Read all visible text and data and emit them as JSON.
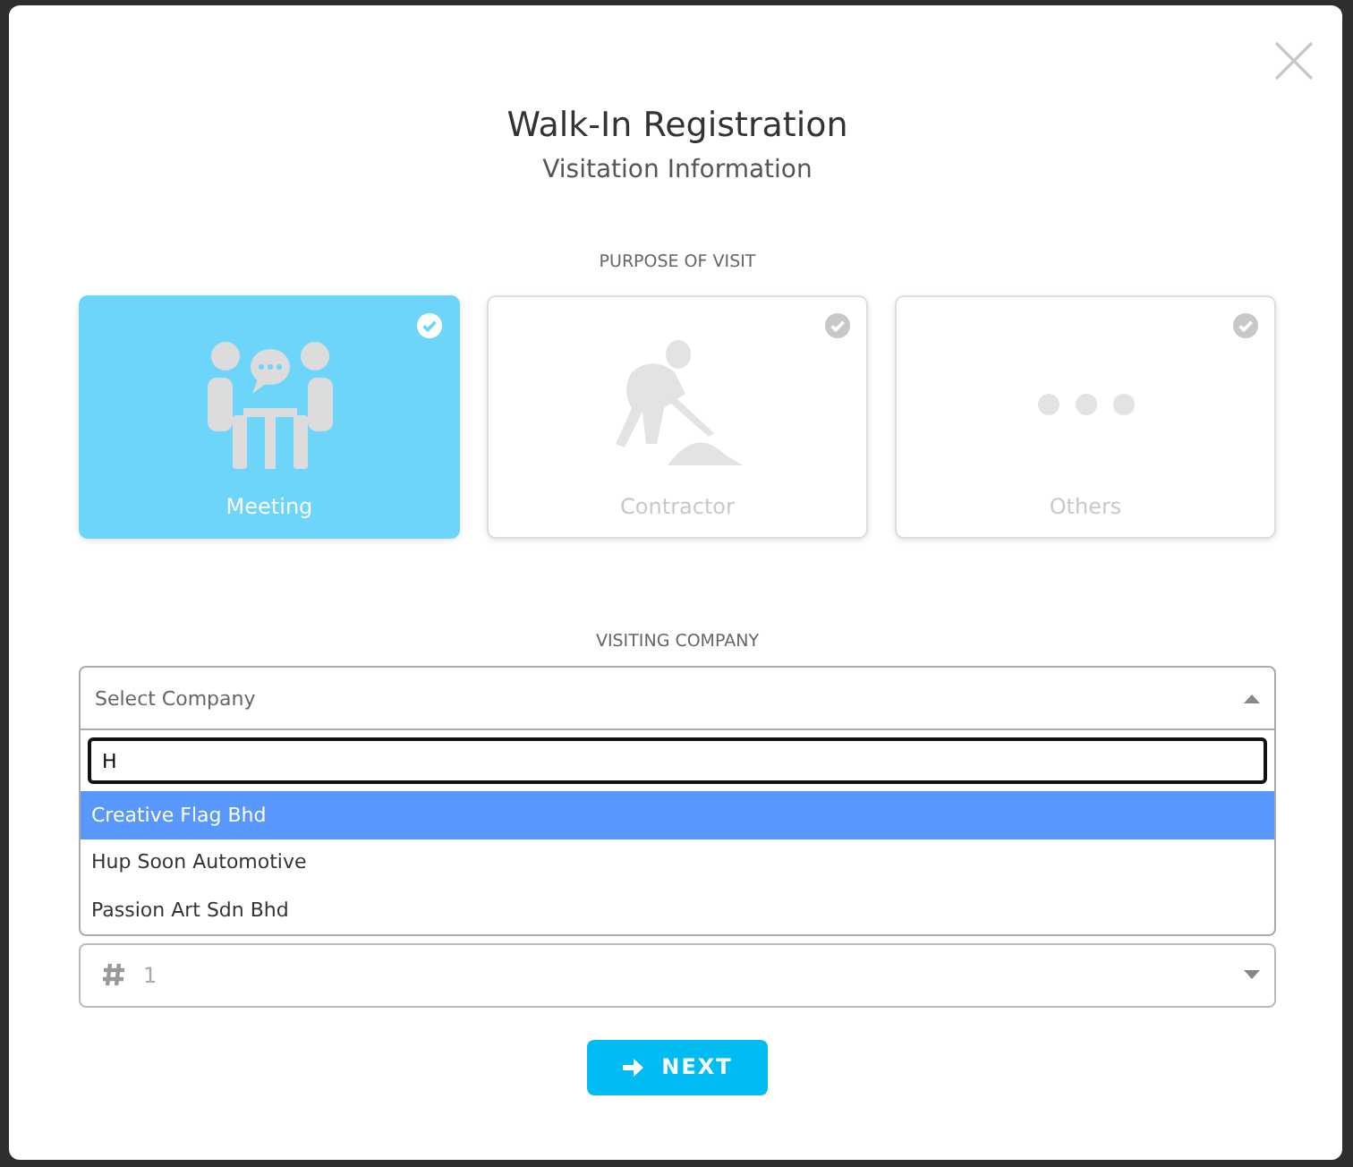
{
  "dialog": {
    "title": "Walk-In Registration",
    "subtitle": "Visitation Information"
  },
  "purpose": {
    "label": "PURPOSE OF VISIT",
    "options": [
      {
        "label": "Meeting",
        "kind": "meeting",
        "selected": true
      },
      {
        "label": "Contractor",
        "kind": "contractor",
        "selected": false
      },
      {
        "label": "Others",
        "kind": "others",
        "selected": false
      }
    ]
  },
  "company": {
    "label": "VISITING COMPANY",
    "placeholder": "Select Company",
    "expanded": true,
    "search": "H",
    "options": [
      {
        "label": "Creative Flag Bhd",
        "selected": true
      },
      {
        "label": "Hup Soon Automotive",
        "selected": false
      },
      {
        "label": "Passion Art Sdn Bhd",
        "selected": false
      }
    ]
  },
  "visitors": {
    "value": "1"
  },
  "next_button": {
    "label": "NEXT"
  }
}
